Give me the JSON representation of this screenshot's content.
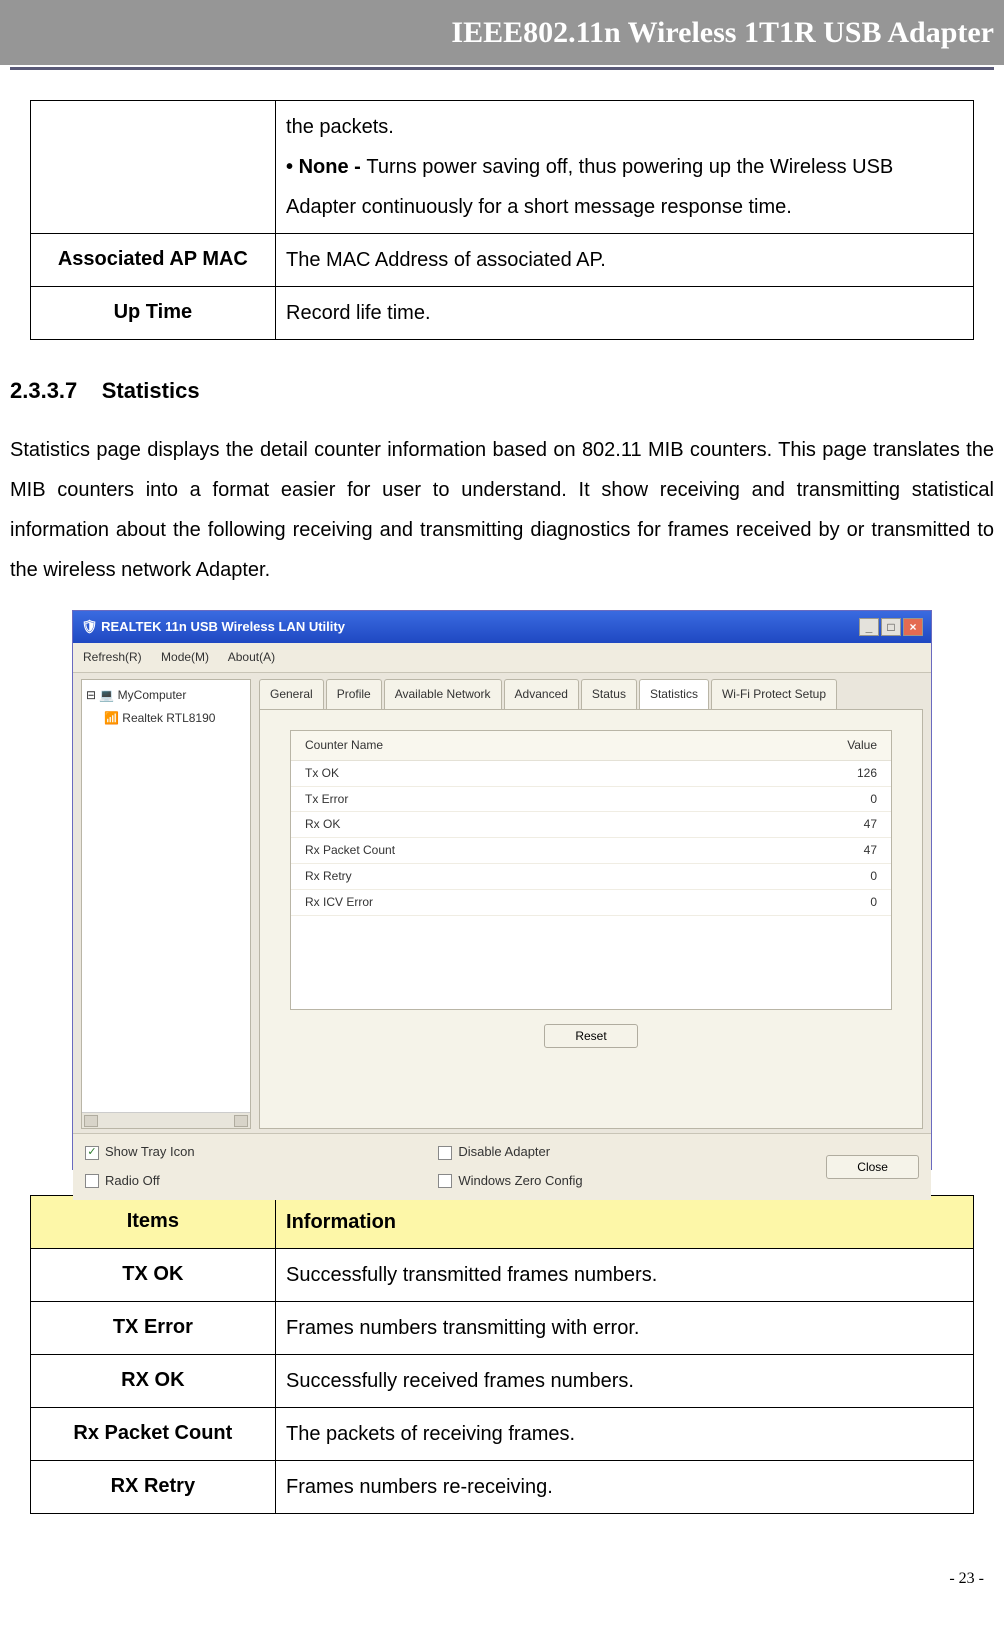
{
  "header": {
    "title": "IEEE802.11n Wireless 1T1R USB Adapter"
  },
  "table1": {
    "row1": {
      "desc_pre": "the packets.",
      "none_label": "• None - ",
      "none_desc": "Turns power saving off, thus powering up the Wireless USB Adapter continuously for a short message response time."
    },
    "row2": {
      "label": "Associated AP MAC",
      "desc": "The MAC Address of associated AP."
    },
    "row3": {
      "label": "Up Time",
      "desc": "Record life time."
    }
  },
  "section": {
    "num": "2.3.3.7",
    "title": "Statistics",
    "para": "Statistics page displays the detail counter information based on 802.11 MIB counters. This page translates the MIB counters into a format easier for user to understand. It show receiving and transmitting statistical information about the following receiving and transmitting diagnostics for frames received by or transmitted to the wireless network Adapter."
  },
  "screenshot": {
    "title": "REALTEK 11n USB Wireless LAN Utility",
    "menu": {
      "refresh": "Refresh(R)",
      "mode": "Mode(M)",
      "about": "About(A)"
    },
    "tree": {
      "root": "MyComputer",
      "child": "Realtek RTL8190"
    },
    "tabs": {
      "general": "General",
      "profile": "Profile",
      "available": "Available Network",
      "advanced": "Advanced",
      "status": "Status",
      "statistics": "Statistics",
      "wps": "Wi-Fi Protect Setup"
    },
    "counters": {
      "hdr_name": "Counter Name",
      "hdr_value": "Value",
      "rows": [
        {
          "name": "Tx OK",
          "value": "126"
        },
        {
          "name": "Tx Error",
          "value": "0"
        },
        {
          "name": "Rx OK",
          "value": "47"
        },
        {
          "name": "Rx Packet Count",
          "value": "47"
        },
        {
          "name": "Rx Retry",
          "value": "0"
        },
        {
          "name": "Rx ICV Error",
          "value": "0"
        }
      ]
    },
    "reset_btn": "Reset",
    "bottom": {
      "show_tray": "Show Tray Icon",
      "radio_off": "Radio Off",
      "disable_adapter": "Disable Adapter",
      "wzc": "Windows Zero Config",
      "close": "Close"
    }
  },
  "table2": {
    "hdr_items": "Items",
    "hdr_info": "Information",
    "rows": [
      {
        "label": "TX OK",
        "desc": "Successfully transmitted frames numbers."
      },
      {
        "label": "TX Error",
        "desc": "Frames numbers transmitting with error."
      },
      {
        "label": "RX OK",
        "desc": "Successfully received frames numbers."
      },
      {
        "label": "Rx Packet Count",
        "desc": "The packets of receiving frames."
      },
      {
        "label": "RX Retry",
        "desc": "Frames numbers re-receiving."
      }
    ]
  },
  "footer": {
    "page": "- 23 -"
  }
}
